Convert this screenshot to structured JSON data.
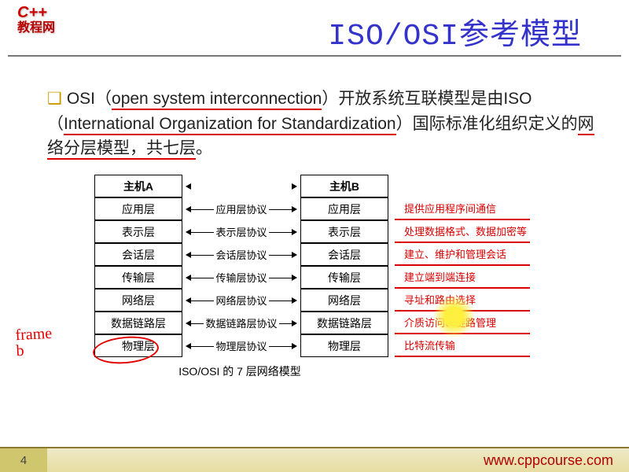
{
  "logo": {
    "line1": "C++",
    "line2": "教程网"
  },
  "title": "ISO/OSI参考模型",
  "bullet": {
    "prefix": "OSI（",
    "under1": "open system interconnection",
    "mid1": "）开放系统互联模型是由ISO（",
    "under2": "International Organization for Standardization",
    "mid2": "）国际标准化组织定义的",
    "under3": "网络分层模型，共七层",
    "suffix": "。"
  },
  "headers": {
    "a": "主机A",
    "b": "主机B"
  },
  "layers": [
    {
      "a": "应用层",
      "p": "应用层协议",
      "b": "应用层",
      "d": "提供应用程序间通信"
    },
    {
      "a": "表示层",
      "p": "表示层协议",
      "b": "表示层",
      "d": "处理数据格式、数据加密等"
    },
    {
      "a": "会话层",
      "p": "会话层协议",
      "b": "会话层",
      "d": "建立、维护和管理会话"
    },
    {
      "a": "传输层",
      "p": "传输层协议",
      "b": "传输层",
      "d": "建立端到端连接"
    },
    {
      "a": "网络层",
      "p": "网络层协议",
      "b": "网络层",
      "d": "寻址和路由选择"
    },
    {
      "a": "数据链路层",
      "p": "数据链路层协议",
      "b": "数据链路层",
      "d": "介质访问、链路管理"
    },
    {
      "a": "物理层",
      "p": "物理层协议",
      "b": "物理层",
      "d": "比特流传输"
    }
  ],
  "caption": "ISO/OSI 的 7 层网络模型",
  "handwriting": {
    "l1": "frame",
    "l2": "b"
  },
  "page": "4",
  "url": "www.cppcourse.com"
}
